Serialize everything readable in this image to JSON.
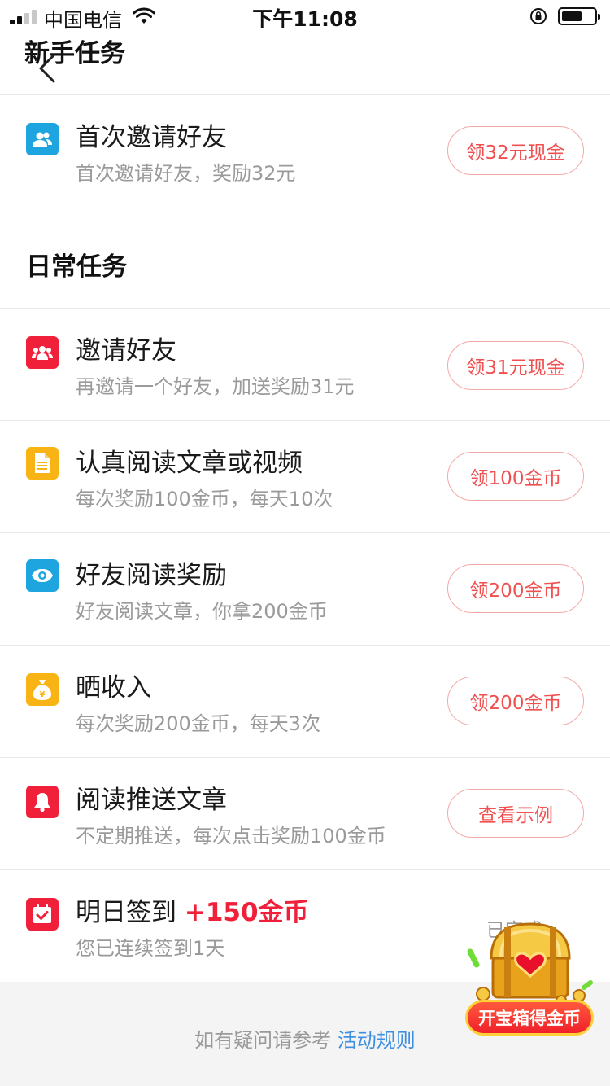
{
  "status_bar": {
    "carrier": "中国电信",
    "time": "下午11:08",
    "battery_level": 0.6
  },
  "header": {
    "section_title": "新手任务"
  },
  "daily_section_title": "日常任务",
  "newbie_tasks": [
    {
      "icon": "users-icon",
      "icon_color": "#1ea5e0",
      "title": "首次邀请好友",
      "desc": "首次邀请好友，奖励32元",
      "button": "领32元现金"
    }
  ],
  "daily_tasks": [
    {
      "icon": "users-icon",
      "icon_color": "#f0203a",
      "title": "邀请好友",
      "desc": "再邀请一个好友，加送奖励31元",
      "button": "领31元现金"
    },
    {
      "icon": "document-icon",
      "icon_color": "#f8b415",
      "title": "认真阅读文章或视频",
      "desc": "每次奖励100金币，每天10次",
      "button": "领100金币"
    },
    {
      "icon": "eye-icon",
      "icon_color": "#1ea5e0",
      "title": "好友阅读奖励",
      "desc": "好友阅读文章，你拿200金币",
      "button": "领200金币"
    },
    {
      "icon": "money-bag-icon",
      "icon_color": "#f8b415",
      "title": "晒收入",
      "desc": "每次奖励200金币，每天3次",
      "button": "领200金币"
    },
    {
      "icon": "bell-icon",
      "icon_color": "#f0203a",
      "title": "阅读推送文章",
      "desc": "不定期推送，每次点击奖励100金币",
      "button": "查看示例"
    }
  ],
  "checkin": {
    "icon": "calendar-check-icon",
    "icon_color": "#f0203a",
    "title": "明日签到",
    "bonus": "+150金币",
    "desc": "您已连续签到1天",
    "status": "已完成"
  },
  "treasure": {
    "label": "开宝箱得金币"
  },
  "footer": {
    "text": "如有疑问请参考",
    "link": "活动规则"
  },
  "colors": {
    "accent_red": "#f0203a",
    "button_border": "#f4a9a9",
    "link_blue": "#3f8fe0",
    "muted": "#9a9a9a"
  }
}
